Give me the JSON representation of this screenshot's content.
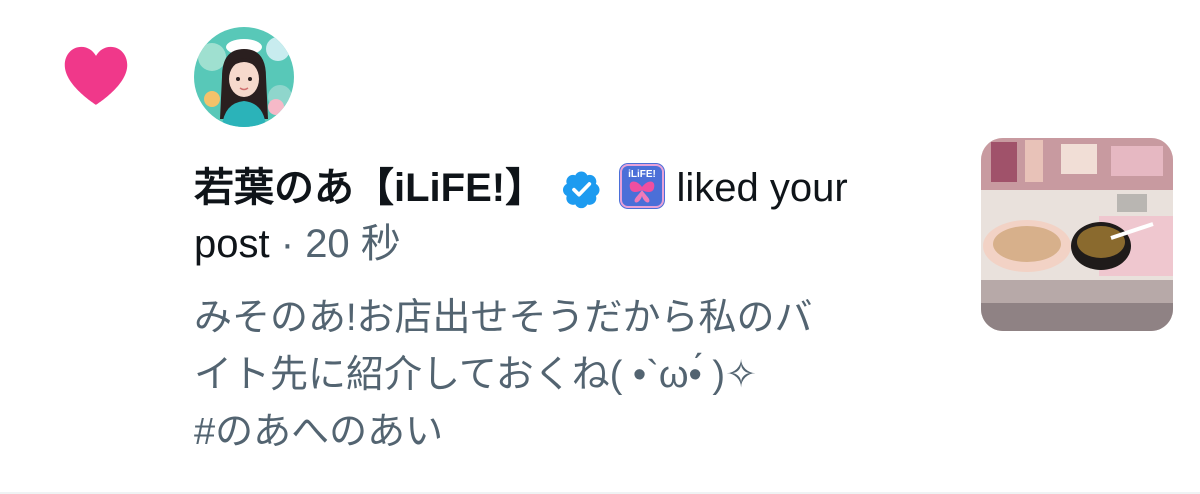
{
  "notification": {
    "action_icon": "heart-icon",
    "actor_name": "若葉のあ【iLiFE!】",
    "verified_badge_icon": "verified-check-icon",
    "affiliation_badge_icon": "ilife-butterfly-logo-icon",
    "action_text": "liked your",
    "object_text": "post",
    "separator": "·",
    "timestamp": "20 秒",
    "post_text_line1": "みそのあ!お店出せそうだから私のバ",
    "post_text_line2": "イト先に紹介しておくね( •`ω•́ )✧",
    "post_text_line3": "#のあへのあい"
  },
  "colors": {
    "heart": "#f91880",
    "verified": "#1d9bf0",
    "primary_text": "#0f1419",
    "secondary_text": "#536471"
  }
}
